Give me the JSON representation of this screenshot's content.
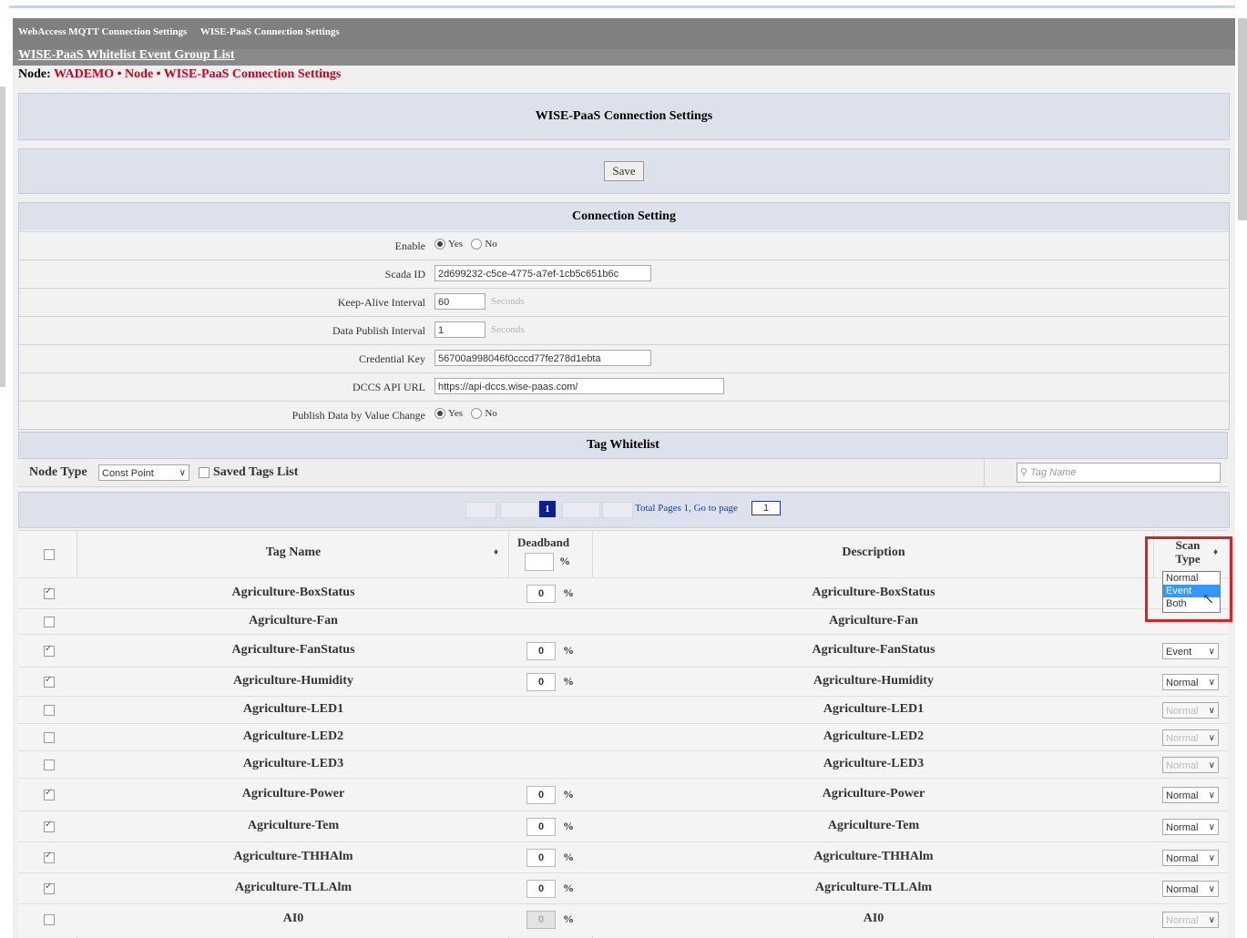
{
  "nav": {
    "links": [
      "WebAccess MQTT Connection Settings",
      "WISE-PaaS Connection Settings"
    ],
    "sub_link": "WISE-PaaS Whitelist Event Group List"
  },
  "breadcrumb": {
    "prefix": "Node:",
    "path": "WADEMO • Node • WISE-PaaS Connection Settings"
  },
  "page_title": "WISE-PaaS Connection Settings",
  "save_label": "Save",
  "connection": {
    "title": "Connection Setting",
    "enable_label": "Enable",
    "yes": "Yes",
    "no": "No",
    "scada_label": "Scada ID",
    "scada_value": "2d699232-c5ce-4775-a7ef-1cb5c651b6c",
    "keepalive_label": "Keep-Alive Interval",
    "keepalive_value": "60",
    "seconds": "Seconds",
    "publish_interval_label": "Data Publish Interval",
    "publish_interval_value": "1",
    "credential_label": "Credential Key",
    "credential_value": "56700a998046f0cccd77fe278d1ebta",
    "dccs_label": "DCCS API URL",
    "dccs_value": "https://api-dccs.wise-paas.com/",
    "pubchange_label": "Publish Data by Value Change"
  },
  "whitelist": {
    "title": "Tag Whitelist",
    "node_type_label": "Node Type",
    "node_type_value": "Const Point",
    "saved_tags_label": "Saved Tags List",
    "search_placeholder": "Tag Name",
    "pager_current": "1",
    "pager_text": "Total Pages 1,  Go to page",
    "pager_goto": "1",
    "col_tagname": "Tag Name",
    "col_deadband": "Deadband",
    "col_description": "Description",
    "col_scantype": "Scan Type",
    "percent": "%",
    "dropdown_options": [
      "Normal",
      "Event",
      "Both"
    ],
    "rows": [
      {
        "name": "Agriculture-BoxStatus",
        "checked": true,
        "deadband": "0",
        "desc": "Agriculture-BoxStatus",
        "scan": ""
      },
      {
        "name": "Agriculture-Fan",
        "checked": false,
        "deadband": "",
        "desc": "Agriculture-Fan",
        "scan": ""
      },
      {
        "name": "Agriculture-FanStatus",
        "checked": true,
        "deadband": "0",
        "desc": "Agriculture-FanStatus",
        "scan": "Event"
      },
      {
        "name": "Agriculture-Humidity",
        "checked": true,
        "deadband": "0",
        "desc": "Agriculture-Humidity",
        "scan": "Normal"
      },
      {
        "name": "Agriculture-LED1",
        "checked": false,
        "deadband": "",
        "desc": "Agriculture-LED1",
        "scan": "Normal"
      },
      {
        "name": "Agriculture-LED2",
        "checked": false,
        "deadband": "",
        "desc": "Agriculture-LED2",
        "scan": "Normal"
      },
      {
        "name": "Agriculture-LED3",
        "checked": false,
        "deadband": "",
        "desc": "Agriculture-LED3",
        "scan": "Normal"
      },
      {
        "name": "Agriculture-Power",
        "checked": true,
        "deadband": "0",
        "desc": "Agriculture-Power",
        "scan": "Normal"
      },
      {
        "name": "Agriculture-Tem",
        "checked": true,
        "deadband": "0",
        "desc": "Agriculture-Tem",
        "scan": "Normal"
      },
      {
        "name": "Agriculture-THHAlm",
        "checked": true,
        "deadband": "0",
        "desc": "Agriculture-THHAlm",
        "scan": "Normal"
      },
      {
        "name": "Agriculture-TLLAlm",
        "checked": true,
        "deadband": "0",
        "desc": "Agriculture-TLLAlm",
        "scan": "Normal"
      },
      {
        "name": "AI0",
        "checked": false,
        "deadband": "0",
        "desc": "AI0",
        "scan": "Normal"
      }
    ]
  },
  "colors": {
    "red": "#d1001f",
    "highlight": "#3399ff",
    "section": "#dde1ec"
  }
}
